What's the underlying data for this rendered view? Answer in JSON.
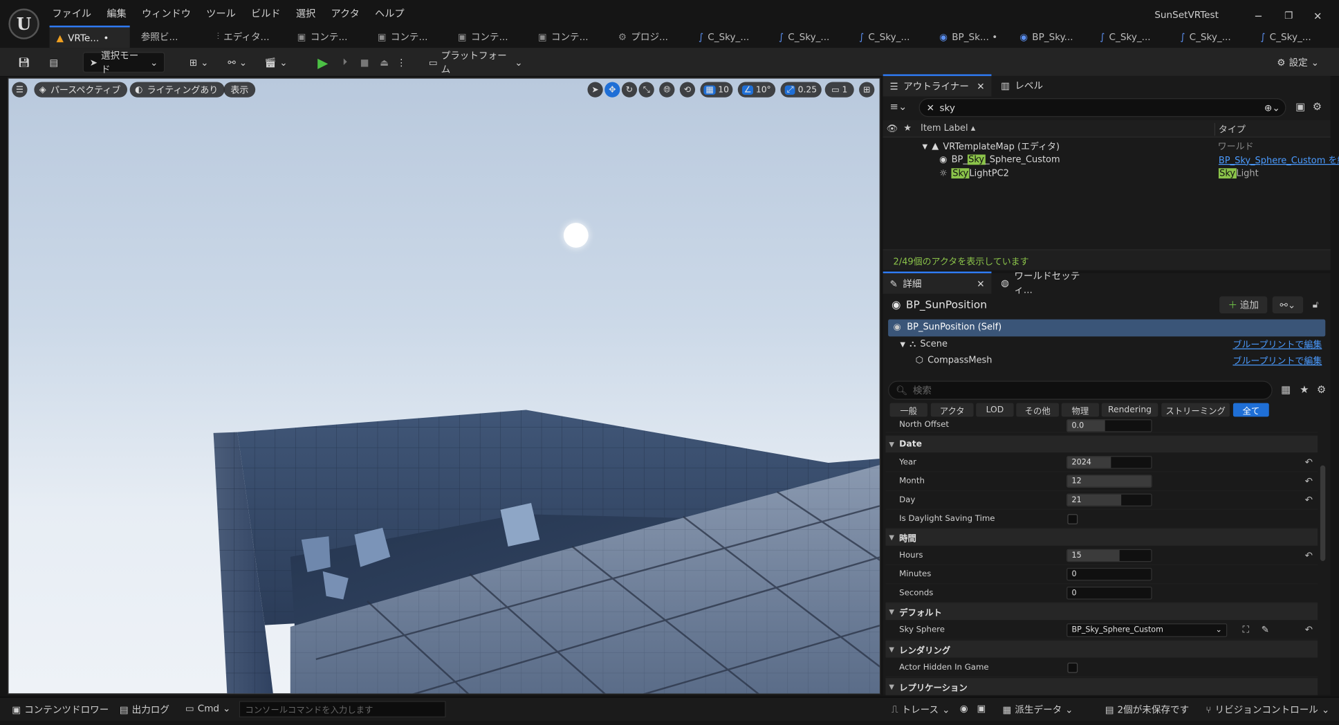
{
  "app": {
    "logo": "U",
    "menu": [
      "ファイル",
      "編集",
      "ウィンドウ",
      "ツール",
      "ビルド",
      "選択",
      "アクタ",
      "ヘルプ"
    ],
    "project_name": "SunSetVRTest",
    "window_controls": {
      "minimize": "─",
      "restore": "❐",
      "close": "✕"
    }
  },
  "tabs": [
    {
      "label": "VRTe...",
      "icon": "level-icon",
      "modified": "•"
    },
    {
      "label": "参照ビ...",
      "icon": "reference-viewer-icon"
    },
    {
      "label": "エディタ...",
      "icon": "editor-icon"
    },
    {
      "label": "コンテ...",
      "icon": "content-icon"
    },
    {
      "label": "コンテ...",
      "icon": "content-icon"
    },
    {
      "label": "コンテ...",
      "icon": "content-icon"
    },
    {
      "label": "コンテ...",
      "icon": "content-icon"
    },
    {
      "label": "プロジ...",
      "icon": "project-icon"
    },
    {
      "label": "C_Sky_...",
      "icon": "curve-icon"
    },
    {
      "label": "C_Sky_...",
      "icon": "curve-icon"
    },
    {
      "label": "C_Sky_...",
      "icon": "curve-icon"
    },
    {
      "label": "BP_Sk... •",
      "icon": "blueprint-icon"
    },
    {
      "label": "BP_Sky...",
      "icon": "blueprint-icon"
    },
    {
      "label": "C_Sky_...",
      "icon": "curve-icon"
    },
    {
      "label": "C_Sky_...",
      "icon": "curve-icon"
    },
    {
      "label": "C_Sky_...",
      "icon": "curve-icon"
    }
  ],
  "toolbar": {
    "select_mode": "選択モード",
    "platform": "プラットフォーム",
    "settings": "設定"
  },
  "viewport": {
    "perspective": "パースペクティブ",
    "lighting": "ライティングあり",
    "show": "表示",
    "grid_snap": "10",
    "rot_snap": "10°",
    "scale_snap": "0.25",
    "camera_speed": "1"
  },
  "outliner": {
    "tab_label": "アウトライナー",
    "tab_level": "レベル",
    "search_value": "sky",
    "col_label": "Item Label ▴",
    "col_type": "タイプ",
    "world_row": {
      "label": "VRTemplateMap (エディタ)",
      "type": "ワールド"
    },
    "rows": [
      {
        "pre": "BP_",
        "hl": "Sky",
        "post": "_Sphere_Custom",
        "type": "BP_Sky_Sphere_Custom を編"
      },
      {
        "pre": "",
        "hl": "Sky",
        "post": "LightPC2",
        "type_hl": "Sky",
        "type_post": "Light"
      }
    ],
    "status": "2/49個のアクタを表示しています"
  },
  "details": {
    "tab_label": "詳細",
    "tab_world": "ワールドセッティ...",
    "actor_name": "BP_SunPosition",
    "add_button": "追加",
    "components": [
      {
        "label": "BP_SunPosition (Self)"
      },
      {
        "label": "Scene",
        "link": "ブループリントで編集"
      },
      {
        "label": "CompassMesh",
        "link": "ブループリントで編集"
      }
    ],
    "search_placeholder": "検索",
    "categories": [
      "一般",
      "アクタ",
      "LOD",
      "その他",
      "物理",
      "Rendering",
      "ストリーミング",
      "全て"
    ],
    "north_offset": {
      "label": "North Offset",
      "value": "0.0"
    },
    "date_section": "Date",
    "year": {
      "label": "Year",
      "value": "2024"
    },
    "month": {
      "label": "Month",
      "value": "12"
    },
    "day": {
      "label": "Day",
      "value": "21"
    },
    "dst": {
      "label": "Is Daylight Saving Time"
    },
    "time_section": "時間",
    "hours": {
      "label": "Hours",
      "value": "15"
    },
    "minutes": {
      "label": "Minutes",
      "value": "0"
    },
    "seconds": {
      "label": "Seconds",
      "value": "0"
    },
    "default_section": "デフォルト",
    "sky_sphere": {
      "label": "Sky Sphere",
      "value": "BP_Sky_Sphere_Custom"
    },
    "rendering_section": "レンダリング",
    "hidden_in_game": {
      "label": "Actor Hidden In Game"
    },
    "replication_section": "レプリケーション"
  },
  "statusbar": {
    "content_drawer": "コンテンツドロワー",
    "output_log": "出力ログ",
    "cmd": "Cmd",
    "cmd_placeholder": "コンソールコマンドを入力します",
    "trace": "トレース",
    "derived_data": "派生データ",
    "unsaved": "2個が未保存です",
    "revision_control": "リビジョンコントロール"
  },
  "colors": {
    "accent": "#2f7bf5",
    "highlight": "#8bc34a",
    "link": "#4b9bff"
  }
}
